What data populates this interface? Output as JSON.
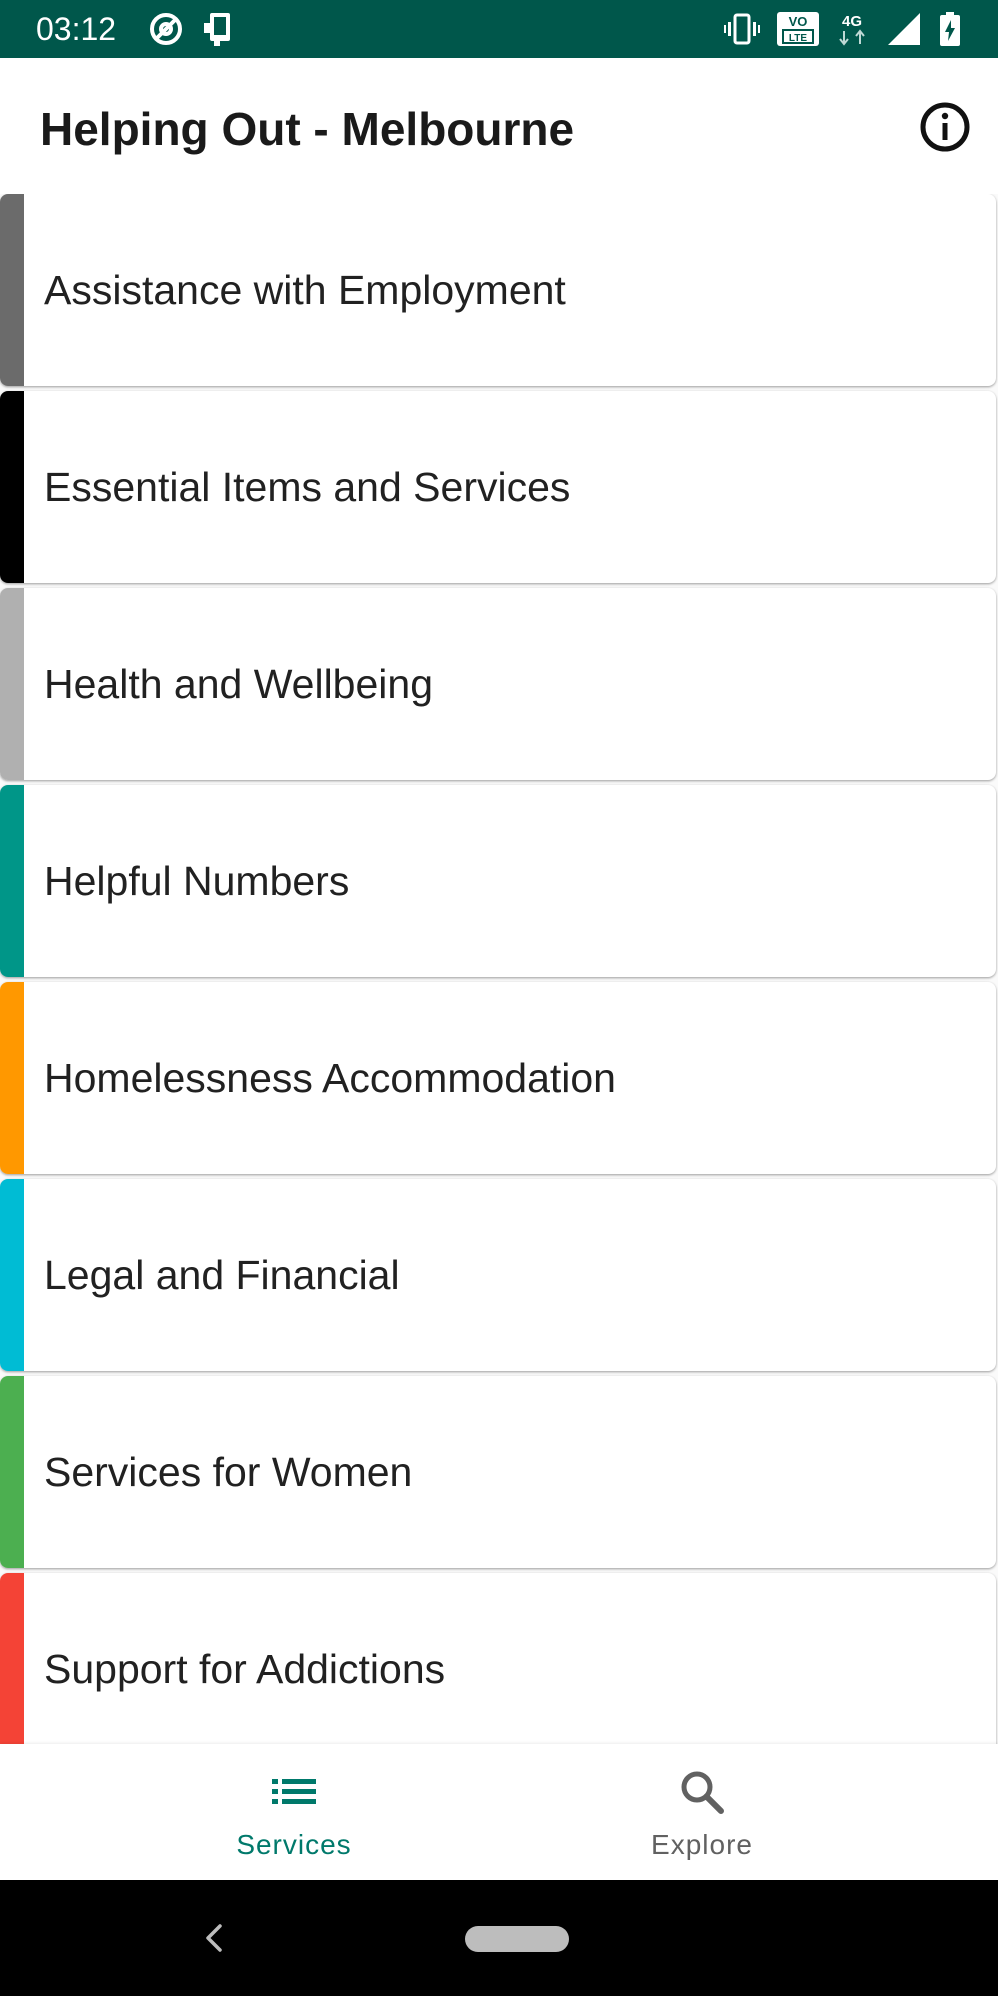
{
  "status_bar": {
    "time": "03:12",
    "left_icons": [
      "at-sign-icon",
      "device-icon"
    ],
    "right_icons": [
      "vibrate-icon",
      "volte-icon",
      "4g-icon",
      "signal-icon",
      "battery-charging-icon"
    ],
    "volte_text_top": "VO",
    "volte_text_bottom": "LTE",
    "network": "4G",
    "background_color": "#00574b"
  },
  "app_bar": {
    "title": "Helping Out - Melbourne",
    "action_icon": "info-icon"
  },
  "services": [
    {
      "label": "Assistance with Employment",
      "color": "#6b6b6b"
    },
    {
      "label": "Essential Items and Services",
      "color": "#000000"
    },
    {
      "label": "Health and Wellbeing",
      "color": "#b0b0b0"
    },
    {
      "label": "Helpful Numbers",
      "color": "#009688"
    },
    {
      "label": "Homelessness Accommodation",
      "color": "#ff9800"
    },
    {
      "label": "Legal and Financial",
      "color": "#00bcd4"
    },
    {
      "label": "Services for Women",
      "color": "#4caf50"
    },
    {
      "label": "Support for Addictions",
      "color": "#f44336"
    }
  ],
  "bottom_nav": {
    "items": [
      {
        "label": "Services",
        "icon": "list-icon",
        "selected": true
      },
      {
        "label": "Explore",
        "icon": "search-icon",
        "selected": false
      }
    ],
    "active_color": "#00796b",
    "inactive_color": "#616161"
  },
  "system_nav": {
    "back_icon": "back-chevron-icon",
    "home_icon": "home-pill-icon"
  }
}
